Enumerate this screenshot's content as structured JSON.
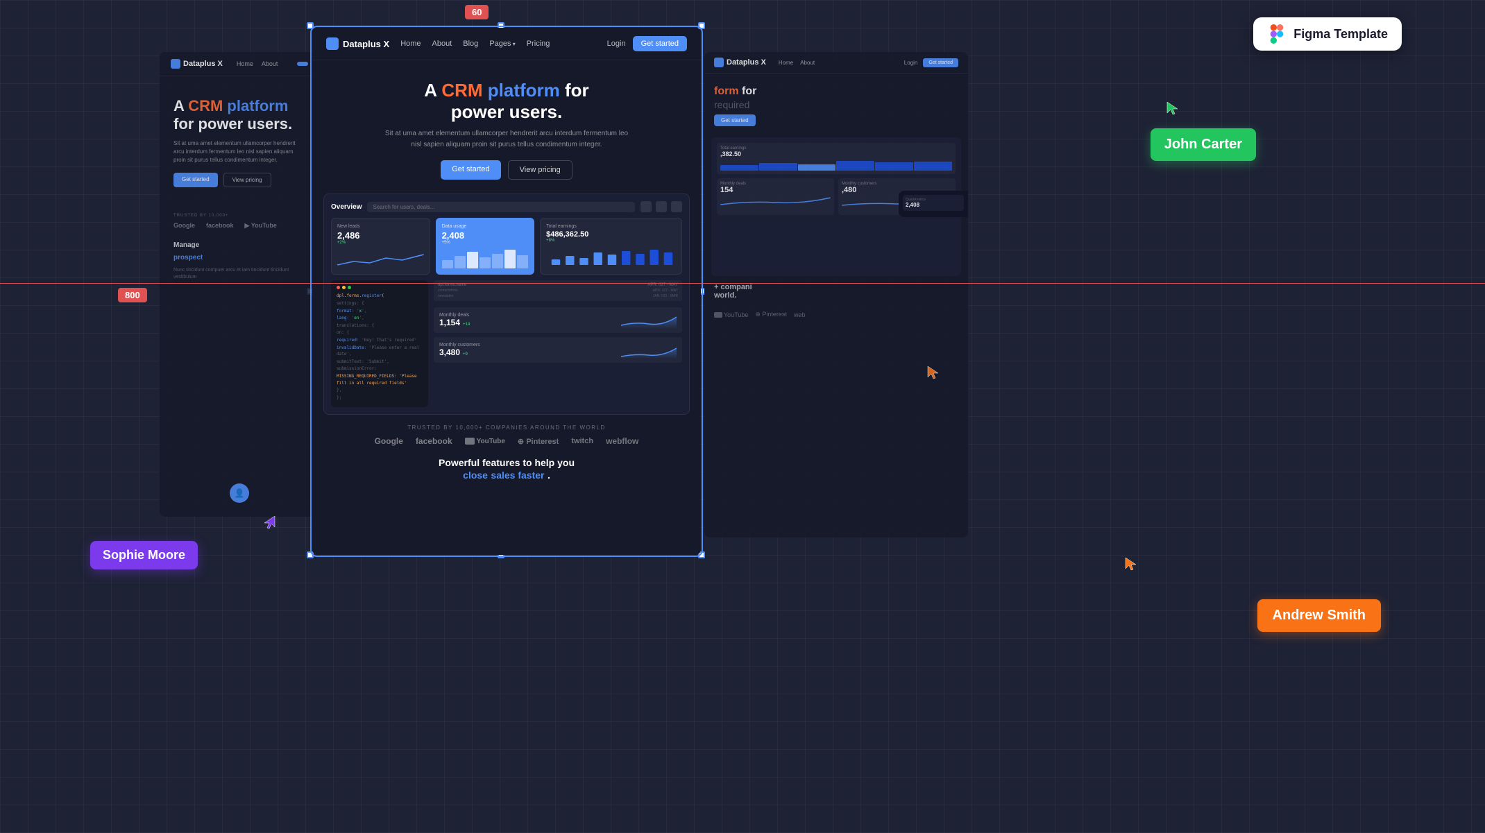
{
  "canvas": {
    "bg_color": "#1e2235",
    "grid": true
  },
  "width_label": "60",
  "height_label": "800",
  "figma_badge": {
    "icon": "figma-icon",
    "label": "Figma Template"
  },
  "user_badges": {
    "john_carter": {
      "name": "John Carter",
      "bg_color": "#22c55e"
    },
    "sophie_moore": {
      "name": "Sophie Moore",
      "bg_color": "#7c3aed"
    },
    "andrew_smith": {
      "name": "Andrew Smith",
      "bg_color": "#f97316"
    }
  },
  "main_frame": {
    "nav": {
      "logo": "Dataplus X",
      "links": [
        "Home",
        "About",
        "Blog",
        "Pages",
        "Pricing"
      ],
      "login": "Login",
      "cta": "Get started"
    },
    "hero": {
      "headline_1": "A CRM platform for",
      "headline_crm": "CRM",
      "headline_platform": "platform",
      "headline_2": "power users.",
      "description": "Sit at uma amet elementum ullamcorper hendrerit arcu interdum fermentum leo nisl sapien aliquam proin sit purus tellus condimentum integer.",
      "cta_primary": "Get started",
      "cta_secondary": "View pricing"
    },
    "dashboard": {
      "title": "Overview",
      "search_placeholder": "Search for users, deals...",
      "stats": [
        {
          "label": "New leads",
          "value": "2,486",
          "change": "+2%"
        },
        {
          "label": "Data usage",
          "value": "2,408",
          "change": "+5%",
          "highlighted": true
        },
        {
          "label": "Total earnings",
          "value": "$486,362.50",
          "change": "+8%"
        }
      ],
      "metrics": [
        {
          "label": "Monthly deals",
          "value": "1,154",
          "change": "+14"
        },
        {
          "label": "Monthly customers",
          "value": "3,480",
          "change": "+9"
        }
      ]
    },
    "trusted": {
      "label": "TRUSTED BY 10,000+ COMPANIES AROUND THE WORLD",
      "brands": [
        "Google",
        "facebook",
        "YouTube",
        "Pinterest",
        "twitch",
        "webflow"
      ]
    },
    "features": {
      "text": "Powerful features to help you",
      "highlight_1": "close",
      "highlight_2": "sales faster",
      "period": "."
    }
  },
  "left_preview": {
    "nav": {
      "logo": "Dataplus X",
      "links": [
        "Home",
        "About"
      ]
    },
    "hero": {
      "headline_1": "A CRM platform",
      "headline_2": "for power users.",
      "description": "Sit at uma amet elementum ullamcorper hendrerit arcu interdum fermentum leo nisl sapien aliquam proin sit purus tellus condimentum integer.",
      "cta_primary": "Get started",
      "cta_secondary": "View pricing"
    },
    "trusted": {
      "label": "TRUSTED BY 10,000+",
      "brands": [
        "Google",
        "facebook",
        "YouTube"
      ]
    },
    "features": {
      "text": "Manage",
      "sub": "prospect"
    }
  },
  "right_preview": {
    "nav": {
      "logo": "Dataplus X"
    },
    "hero": {
      "headline_1": "form for",
      "cta": "Get started"
    },
    "stats": [
      {
        "value": ",382.50",
        "label": ""
      },
      {
        "value": "154",
        "label": ""
      },
      {
        "value": ",480",
        "label": ""
      }
    ],
    "trusted": {
      "brands": [
        "YouTube",
        "Pinterest",
        "web"
      ]
    }
  },
  "icons": {
    "figma": "◆",
    "cursor_green": "◀",
    "cursor_orange": "▶",
    "cursor_purple": "◀"
  }
}
